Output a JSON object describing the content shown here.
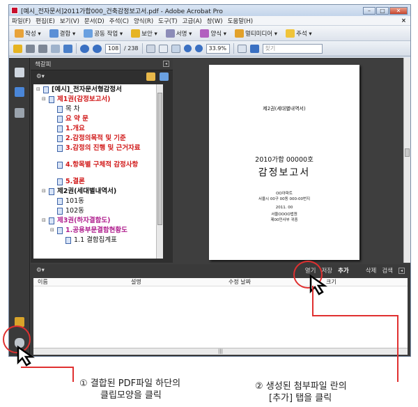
{
  "window": {
    "title": "[예시_전자문서]2011가합000_건축감정보고서.pdf - Adobe Acrobat Pro",
    "controls": [
      "–",
      "□",
      "✕"
    ]
  },
  "menu": [
    "파일(F)",
    "편집(E)",
    "보기(V)",
    "문서(D)",
    "주석(C)",
    "양식(R)",
    "도구(T)",
    "고급(A)",
    "창(W)",
    "도움말(H)"
  ],
  "menu_close": "×",
  "toolbar": [
    "작성 ▾",
    "결합 ▾",
    "공동 작업 ▾",
    "보안 ▾",
    "서명 ▾",
    "양식 ▾",
    "멀티미디어 ▾",
    "주석 ▾"
  ],
  "nav": {
    "page": "108",
    "total": "/ 238",
    "zoom": "33.9%",
    "search_placeholder": "찾기"
  },
  "bookmarks": {
    "title": "책갈피",
    "tools": "⚙▾",
    "items": [
      {
        "text": "[예시]_전자문서형감정서",
        "cls": "blkb",
        "toggle": "⊟"
      },
      {
        "text": "제1권(감정보고서)",
        "cls": "red",
        "toggle": "⊟"
      },
      {
        "text": "목 차",
        "cls": "blk",
        "toggle": ""
      },
      {
        "text": "요 약 문",
        "cls": "red",
        "toggle": ""
      },
      {
        "text": "1.개요",
        "cls": "red",
        "toggle": ""
      },
      {
        "text": "2.감정의목적 및 기준",
        "cls": "red",
        "toggle": ""
      },
      {
        "text": "3.감정의 진행 및 근거자료",
        "cls": "red",
        "toggle": ""
      },
      {
        "text": "4.항목별 구체적 감정사항",
        "cls": "red",
        "toggle": ""
      },
      {
        "text": "5.결론",
        "cls": "red",
        "toggle": ""
      },
      {
        "text": "제2권(세대별내역서)",
        "cls": "blkb",
        "toggle": "⊟"
      },
      {
        "text": "101동",
        "cls": "blk",
        "toggle": ""
      },
      {
        "text": "102동",
        "cls": "blk",
        "toggle": ""
      },
      {
        "text": "제3권(하자결함도)",
        "cls": "pink",
        "toggle": "⊟"
      },
      {
        "text": "1.공용부문결함현황도",
        "cls": "pink",
        "toggle": "⊟"
      },
      {
        "text": "1.1 결함집계표",
        "cls": "blk",
        "toggle": ""
      }
    ]
  },
  "page_content": {
    "header": "제2권(세대별내역서)",
    "case_no": "2010가합 00000호",
    "doc_title": "감정보고서",
    "lines": [
      "OO아파트",
      "서울시 00구 00동 000-00번지",
      "2011. 00",
      "서울OOOO법원",
      "제00민사부 귀중"
    ]
  },
  "attachments": {
    "tools": "⚙▾",
    "buttons": [
      "열기",
      "저장",
      "추가",
      "삭제",
      "검색"
    ],
    "columns": [
      "이름",
      "설명",
      "수정 날짜",
      "크기"
    ]
  },
  "captions": {
    "left_1": "① 결합된 PDF파일 하단의",
    "left_2": "클립모양을 클릭",
    "right_1": "② 생성된 첨부파일 란의",
    "right_2": "[추가] 탭을 클릭"
  },
  "colors": {
    "highlight": "#e03030",
    "bookmark_red": "#d11a1a",
    "bookmark_pink": "#b0218f"
  }
}
